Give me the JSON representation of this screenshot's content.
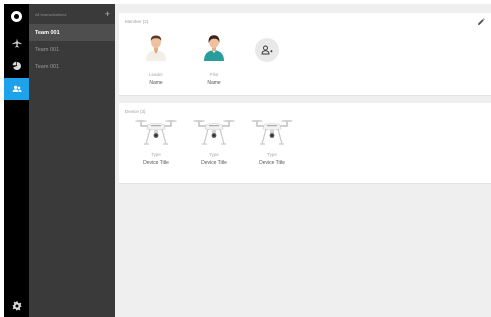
{
  "rail": {
    "items": [
      {
        "icon": "logo-icon"
      },
      {
        "icon": "airplane-icon"
      },
      {
        "icon": "chart-icon"
      },
      {
        "icon": "team-icon",
        "active": true
      },
      {
        "icon": "gear-icon"
      }
    ],
    "accent_color": "#1ca3ec"
  },
  "teams": {
    "header_label": "All teams/stations",
    "add_label": "+",
    "items": [
      {
        "label": "Team 001",
        "active": true
      },
      {
        "label": "Team 001",
        "active": false
      },
      {
        "label": "Team 001",
        "active": false
      }
    ]
  },
  "members": {
    "title": "Member (2)",
    "list": [
      {
        "role": "Leader",
        "name": "Name",
        "icon": "man-avatar-icon"
      },
      {
        "role": "Pilot",
        "name": "Name",
        "icon": "woman-avatar-icon"
      }
    ],
    "add_icon": "add-user-icon",
    "edit_icon": "pencil-icon"
  },
  "devices": {
    "title": "Device (3)",
    "list": [
      {
        "type": "Type",
        "title": "Device Title",
        "icon": "drone-icon"
      },
      {
        "type": "Type",
        "title": "Device Title",
        "icon": "drone-icon"
      },
      {
        "type": "Type",
        "title": "Device Title",
        "icon": "drone-icon"
      }
    ]
  }
}
